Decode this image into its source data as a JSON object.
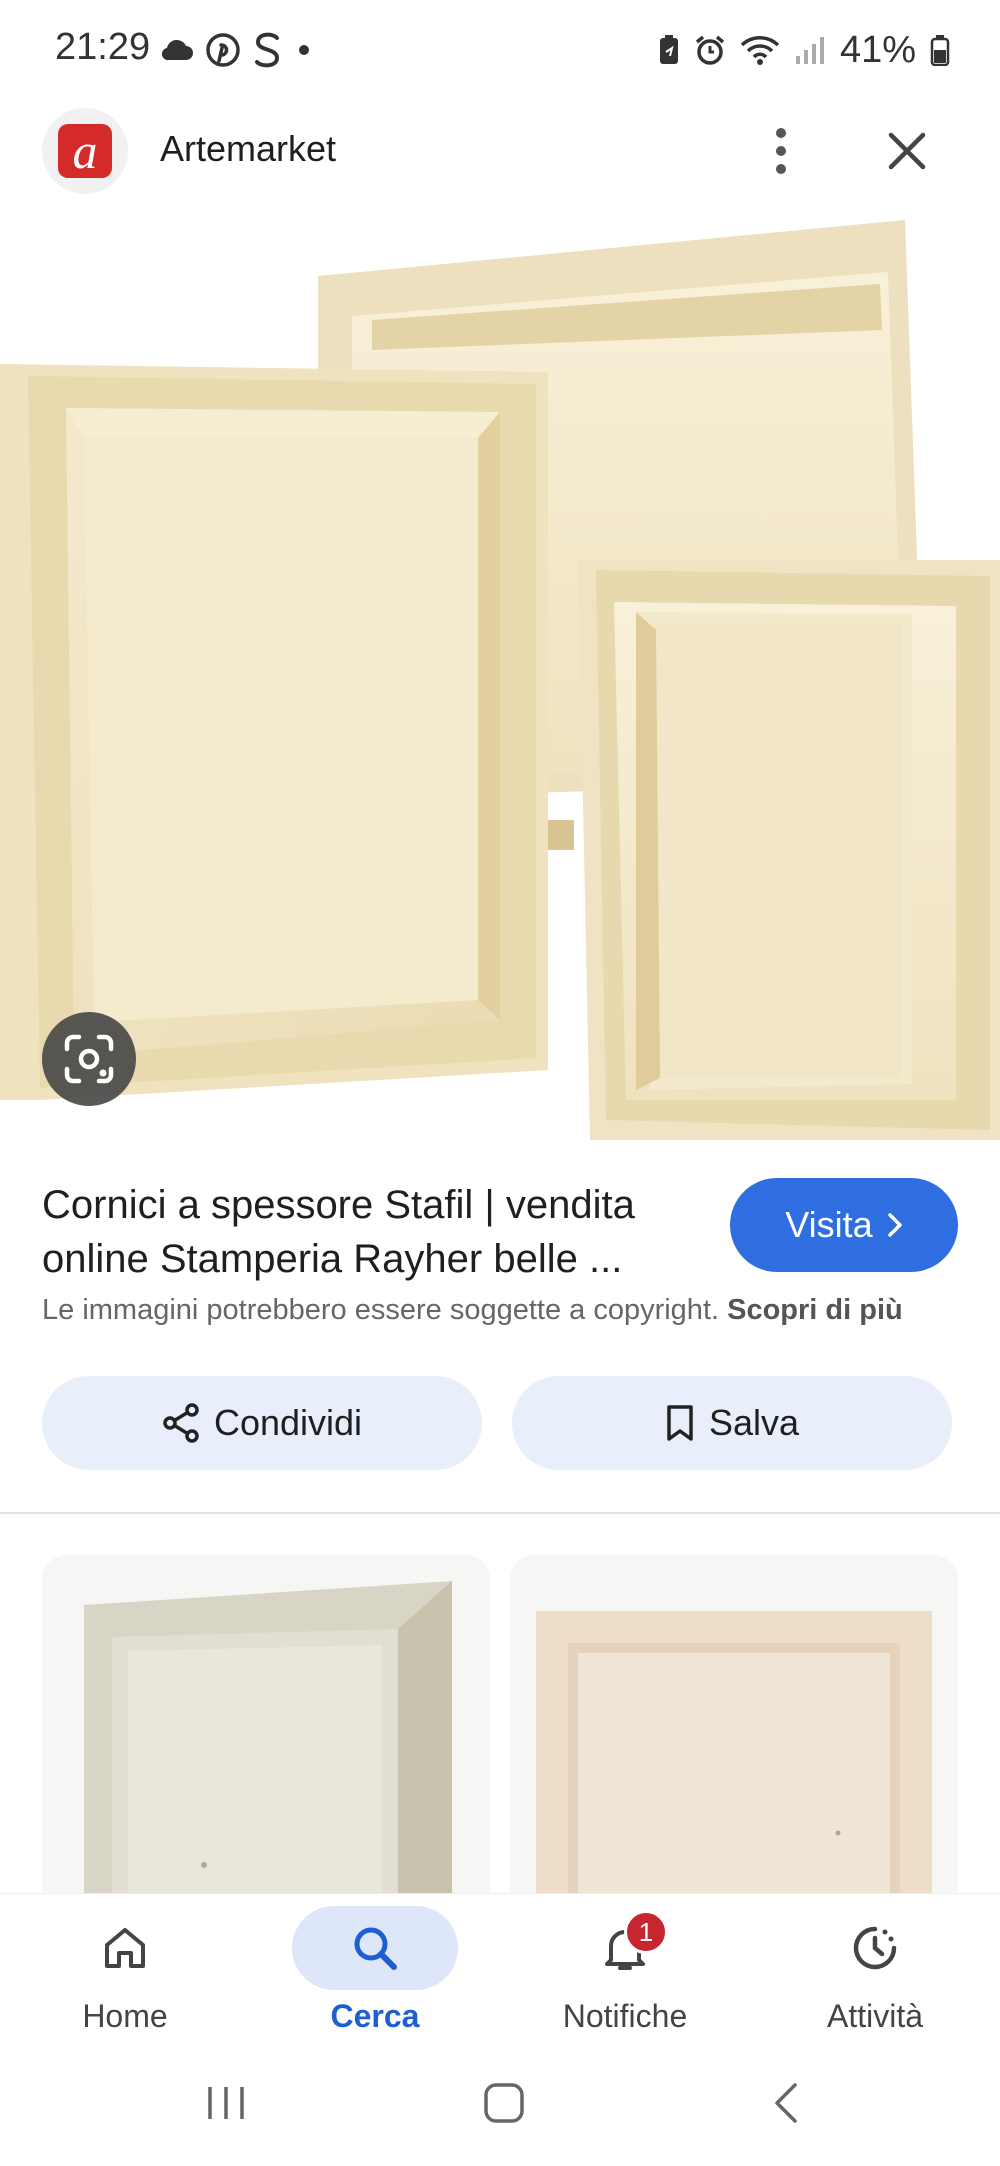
{
  "status_bar": {
    "time": "21:29",
    "battery": "41%",
    "left_icons": [
      "cloud-icon",
      "pinterest-icon",
      "s-app-icon",
      "dot-icon"
    ],
    "right_icons": [
      "battery-saver-icon",
      "alarm-icon",
      "wifi-icon",
      "signal-icon",
      "battery-icon"
    ]
  },
  "header": {
    "logo_letter": "a",
    "site_name": "Artemarket"
  },
  "result": {
    "title": "Cornici a spessore Stafil | vendita online Stamperia Rayher belle ...",
    "visit_label": "Visita",
    "copyright_text": "Le immagini potrebbero essere soggette a copyright.",
    "copyright_link": "Scopri di più"
  },
  "actions": {
    "share_label": "Condividi",
    "save_label": "Salva"
  },
  "bottom_nav": {
    "items": [
      {
        "label": "Home",
        "icon": "home-icon"
      },
      {
        "label": "Cerca",
        "icon": "search-icon",
        "active": true
      },
      {
        "label": "Notifiche",
        "icon": "bell-icon",
        "badge": "1"
      },
      {
        "label": "Attività",
        "icon": "activity-icon"
      }
    ]
  },
  "colors": {
    "accent": "#2f6ee0",
    "active_nav": "#1e5ed4",
    "chip_bg": "#e8effb",
    "badge": "#c6262e",
    "logo": "#d42a2a"
  }
}
